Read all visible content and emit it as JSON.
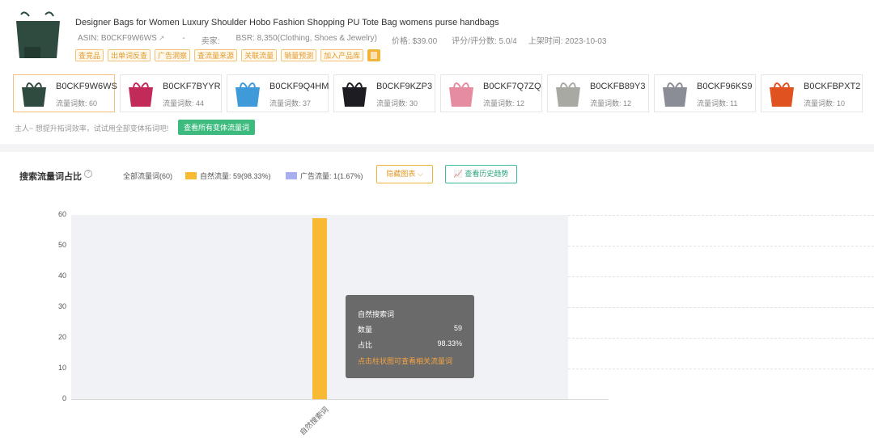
{
  "product": {
    "title": "Designer Bags for Women Luxury Shoulder Hobo Fashion Shopping PU Tote Bag womens purse handbags",
    "asin_label": "ASIN: B0CKF9W6WS",
    "seller_label": "卖家:",
    "seller_value": "-",
    "bsr_label": "BSR: 8,350(Clothing, Shoes & Jewelry)",
    "price_label": "价格: $39.00",
    "rating_label": "评分/评分数: 5.0/4",
    "launch_label": "上架时间: 2023-10-03",
    "tags": [
      "查竞品",
      "出单词反查",
      "广告洞察",
      "查流量来源",
      "关联流量",
      "销量预测",
      "加入产品库"
    ]
  },
  "variants": [
    {
      "asin": "B0CKF9W6WS",
      "count": "流量词数: 60",
      "color": "#2f4a3e",
      "active": true
    },
    {
      "asin": "B0CKF7BYYR",
      "count": "流量词数: 44",
      "color": "#c22a5a",
      "active": false
    },
    {
      "asin": "B0CKF9Q4HM",
      "count": "流量词数: 37",
      "color": "#3e9ad9",
      "active": false
    },
    {
      "asin": "B0CKF9KZP3",
      "count": "流量词数: 30",
      "color": "#1c1c22",
      "active": false
    },
    {
      "asin": "B0CKF7Q7ZQ",
      "count": "流量词数: 12",
      "color": "#e58ca0",
      "active": false
    },
    {
      "asin": "B0CKFB89Y3",
      "count": "流量词数: 12",
      "color": "#a9a9a4",
      "active": false
    },
    {
      "asin": "B0CKF96KS9",
      "count": "流量词数: 11",
      "color": "#8a8d95",
      "active": false
    },
    {
      "asin": "B0CKFBPXT2",
      "count": "流量词数: 10",
      "color": "#e0521f",
      "active": false
    }
  ],
  "hint": {
    "text": "主人~ 想提升拓词效率，试试用全部变体拓词吧!",
    "button": "查看所有变体流量词"
  },
  "chart_section": {
    "title": "搜索流量词占比",
    "legend_all": "全部流量词(60)",
    "legend_organic": "自然流量: 59(98.33%)",
    "legend_ad": "广告流量: 1(1.67%)",
    "btn_hide": "隐藏图表 ⌵",
    "btn_history": "查看历史趋势",
    "colors": {
      "organic": "#f8ba33",
      "ad": "#a9aef0"
    }
  },
  "chart_data": {
    "type": "bar",
    "categories": [
      "自然搜索词"
    ],
    "values": [
      59
    ],
    "ylim": [
      0,
      60
    ],
    "yticks": [
      0,
      10,
      20,
      30,
      40,
      50,
      60
    ],
    "grid": true
  },
  "tooltip": {
    "title": "自然搜索词",
    "count_label": "数量",
    "count_value": "59",
    "ratio_label": "占比",
    "ratio_value": "98.33%",
    "link": "点击柱状图可查看相关流量词"
  }
}
